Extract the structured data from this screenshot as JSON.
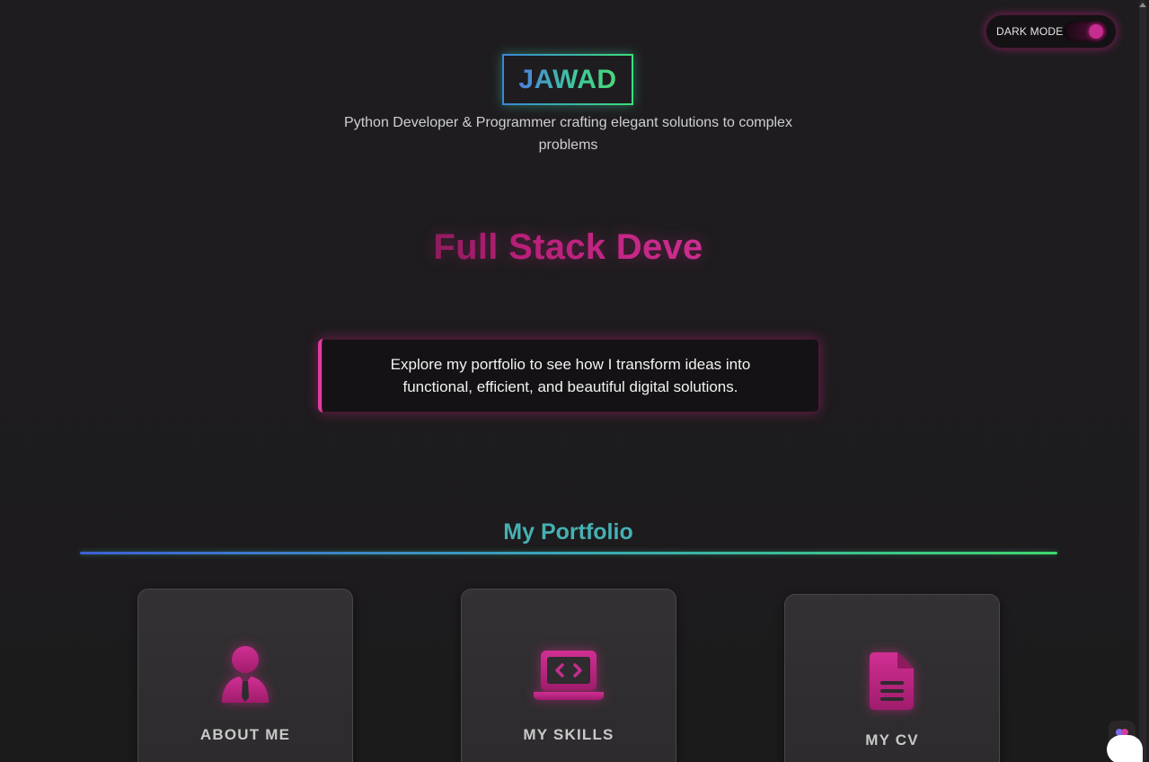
{
  "toggle": {
    "label": "DARK MODE",
    "state": "on"
  },
  "header": {
    "brand": "JAWAD",
    "tagline": "Python Developer & Programmer crafting elegant solutions to complex problems"
  },
  "hero": {
    "role_text": "Full Stack Deve",
    "intro": "Explore my portfolio to see how I transform ideas into functional, efficient, and beautiful digital solutions."
  },
  "portfolio": {
    "title": "My Portfolio",
    "cards": [
      {
        "label": "ABOUT ME",
        "icon": "user-tie-icon"
      },
      {
        "label": "MY SKILLS",
        "icon": "laptop-code-icon"
      },
      {
        "label": "MY CV",
        "icon": "document-icon"
      }
    ]
  },
  "colors": {
    "accent_pink": "#d02f93",
    "gradient_blue": "#3f5fd8",
    "gradient_green": "#3fd76d",
    "background": "#1d1b1d"
  }
}
